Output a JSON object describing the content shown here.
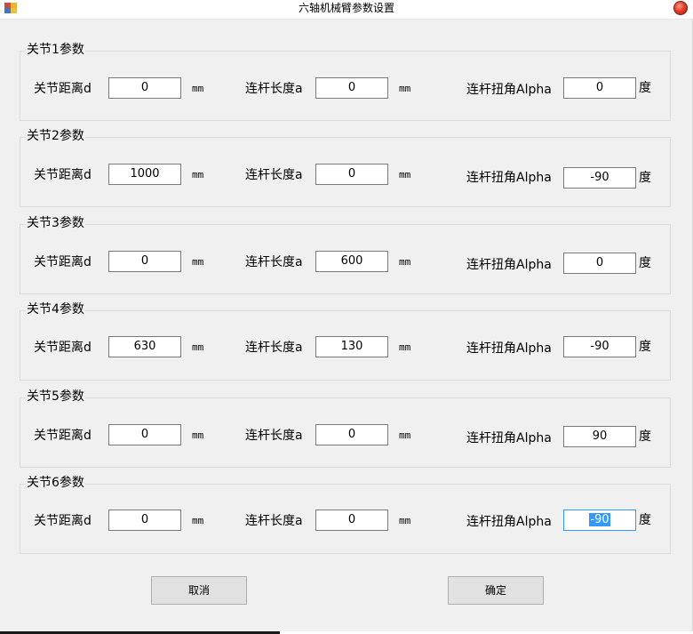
{
  "window": {
    "title": "六轴机械臂参数设置",
    "icon": "app-icon",
    "close_icon": "close-icon"
  },
  "labels": {
    "distance": "关节距离d",
    "length": "连杆长度a",
    "alpha": "连杆扭角Alpha",
    "unit_mm": "mm",
    "unit_deg": "度"
  },
  "joints": [
    {
      "legend": "关节1参数",
      "d": "0",
      "a": "0",
      "alpha": "0"
    },
    {
      "legend": "关节2参数",
      "d": "1000",
      "a": "0",
      "alpha": "-90"
    },
    {
      "legend": "关节3参数",
      "d": "0",
      "a": "600",
      "alpha": "0"
    },
    {
      "legend": "关节4参数",
      "d": "630",
      "a": "130",
      "alpha": "-90"
    },
    {
      "legend": "关节5参数",
      "d": "0",
      "a": "0",
      "alpha": "90"
    },
    {
      "legend": "关节6参数",
      "d": "0",
      "a": "0",
      "alpha": "-90"
    }
  ],
  "buttons": {
    "cancel": "取消",
    "ok": "确定"
  }
}
